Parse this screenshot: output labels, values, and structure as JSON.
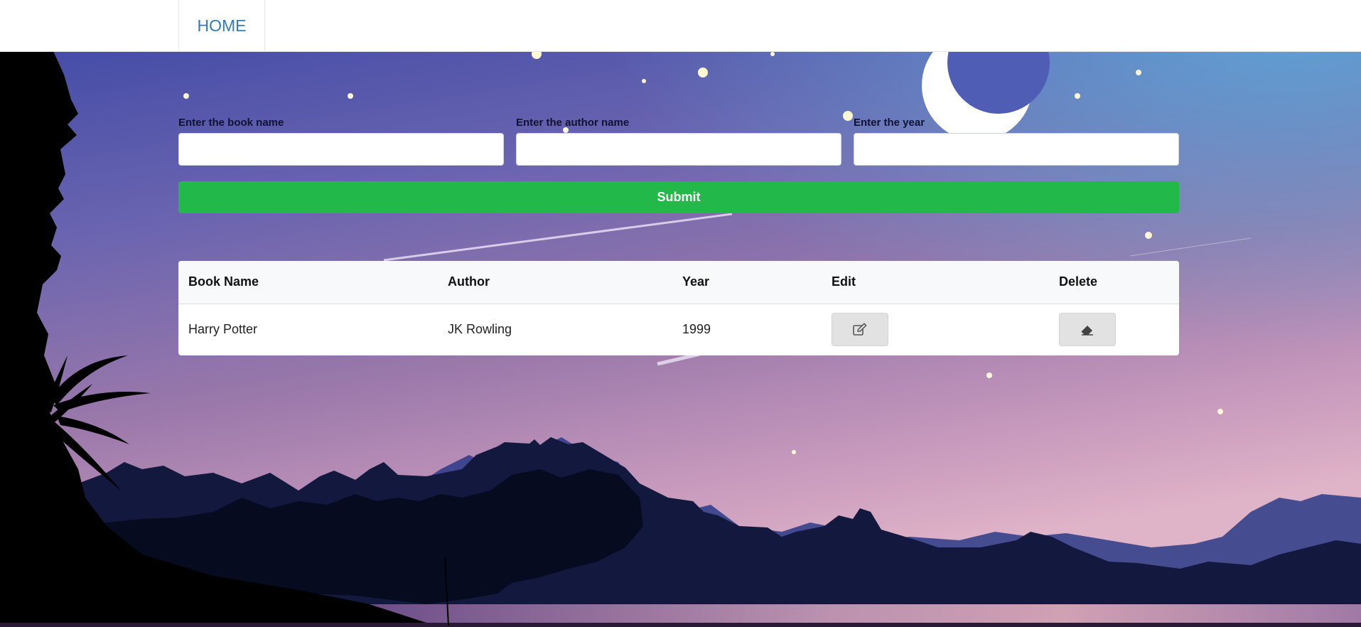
{
  "nav": {
    "home_label": "HOME"
  },
  "form": {
    "book_label": "Enter the book name",
    "author_label": "Enter the author name",
    "year_label": "Enter the year",
    "book_value": "",
    "author_value": "",
    "year_value": "",
    "submit_label": "Submit"
  },
  "table": {
    "headers": [
      "Book Name",
      "Author",
      "Year",
      "Edit",
      "Delete"
    ],
    "rows": [
      {
        "book": "Harry Potter",
        "author": "JK Rowling",
        "year": "1999",
        "edit_icon": "edit-icon",
        "delete_icon": "eraser-icon"
      }
    ]
  },
  "colors": {
    "accent_link": "#337ab7",
    "submit_green": "#22b84a",
    "sky_top": "#3a46a4",
    "sky_bottom": "#d7a7c4"
  }
}
